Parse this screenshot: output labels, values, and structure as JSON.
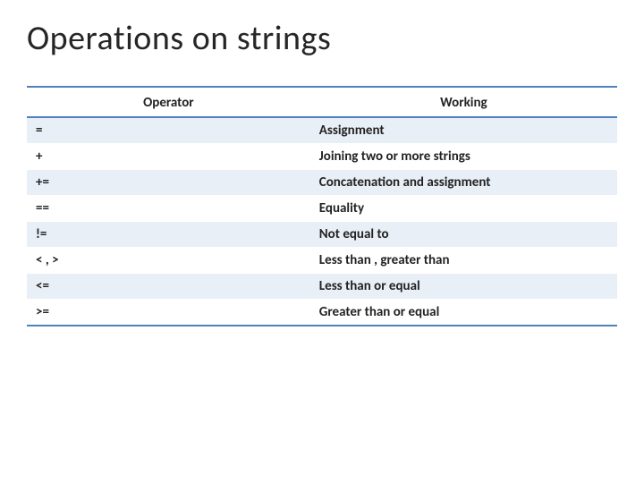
{
  "title": "Operations on strings",
  "headers": {
    "operator": "Operator",
    "working": "Working"
  },
  "rows": [
    {
      "operator": "=",
      "working": "Assignment"
    },
    {
      "operator": "+",
      "working": "Joining two or more strings"
    },
    {
      "operator": "+=",
      "working": "Concatenation and assignment"
    },
    {
      "operator": "==",
      "working": "Equality"
    },
    {
      "operator": "!=",
      "working": "Not equal to"
    },
    {
      "operator": "< , >",
      "working": "Less than , greater than"
    },
    {
      "operator": "<=",
      "working": "Less than or equal"
    },
    {
      "operator": ">=",
      "working": "Greater than or equal"
    }
  ]
}
